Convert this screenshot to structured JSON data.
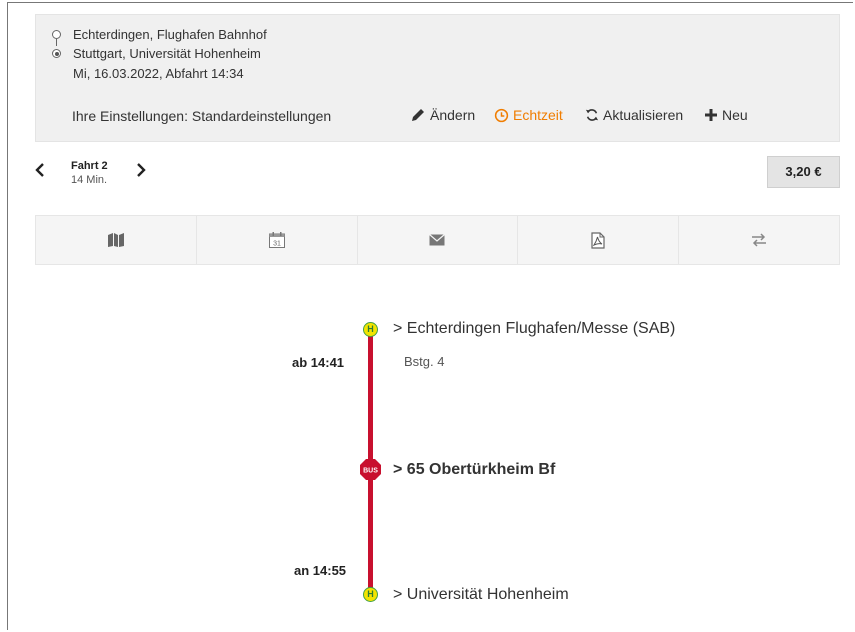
{
  "summary": {
    "from": "Echterdingen, Flughafen Bahnhof",
    "to": "Stuttgart, Universität Hohenheim",
    "date_time": "Mi, 16.03.2022, Abfahrt 14:34",
    "settings": "Ihre Einstellungen: Standardeinstellungen",
    "actions": {
      "edit": "Ändern",
      "realtime": "Echtzeit",
      "refresh": "Aktualisieren",
      "new": "Neu"
    }
  },
  "trip": {
    "label": "Fahrt 2",
    "duration": "14 Min.",
    "price": "3,20 €"
  },
  "toolbar": {
    "icons": [
      "map-icon",
      "calendar-icon",
      "envelope-icon",
      "pdf-icon",
      "swap-icon"
    ],
    "calendar_day": "31"
  },
  "journey": {
    "departure_stop": "> Echterdingen Flughafen/Messe (SAB)",
    "departure_platform": "Bstg. 4",
    "departure_time": "ab 14:41",
    "line": "> 65 Obertürkheim Bf",
    "line_badge": "BUS",
    "stop_badge": "H",
    "arrival_stop": "> Universität Hohenheim",
    "arrival_time": "an 14:55"
  },
  "colors": {
    "accent": "#f07d00",
    "line": "#c8102e",
    "stop_fill": "#f2e400",
    "stop_border": "#43a047"
  }
}
